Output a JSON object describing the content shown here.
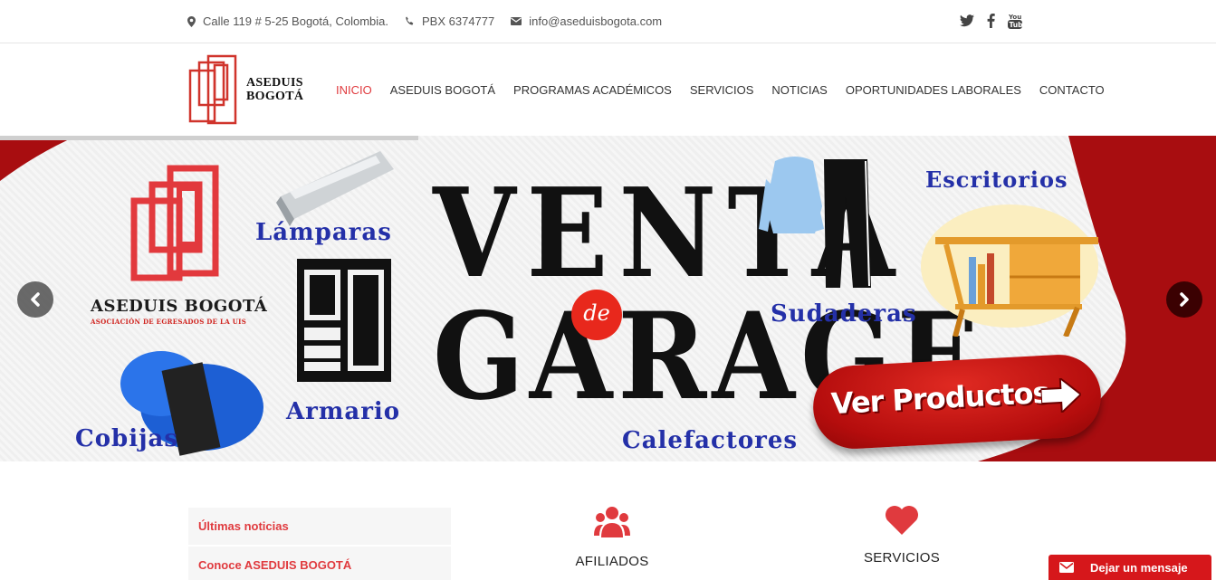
{
  "topbar": {
    "address": "Calle 119 # 5-25 Bogotá, Colombia.",
    "phone": "PBX 6374777",
    "email": "info@aseduisbogota.com"
  },
  "header": {
    "logo_line1": "ASEDUIS",
    "logo_line2": "BOGOTÁ",
    "nav": [
      "INICIO",
      "ASEDUIS BOGOTÁ",
      "PROGRAMAS ACADÉMICOS",
      "SERVICIOS",
      "NOTICIAS",
      "OPORTUNIDADES LABORALES",
      "CONTACTO"
    ],
    "active_nav": "INICIO"
  },
  "hero": {
    "logo_title": "ASEDUIS BOGOTÁ",
    "logo_subtitle": "ASOCIACIÓN DE EGRESADOS DE LA UIS",
    "headline_line1": "VENTA",
    "headline_connector": "de",
    "headline_line2": "GARAGE",
    "items": {
      "lamparas": "Lámparas",
      "armario": "Armario",
      "cobijas": "Cobijas",
      "sudaderas": "Sudaderas",
      "escritorios": "Escritorios",
      "calefactores": "Calefactores"
    },
    "cta": "Ver Productos"
  },
  "sidebar": {
    "items": [
      "Últimas noticias",
      "Conoce ASEDUIS BOGOTÁ"
    ]
  },
  "features": [
    {
      "title": "AFILIADOS",
      "icon": "users-icon"
    },
    {
      "title": "SERVICIOS",
      "icon": "heart-icon"
    }
  ],
  "chat": {
    "label": "Dejar un mensaje"
  },
  "colors": {
    "accent": "#e03a3e",
    "hero_red": "#b50d0d",
    "hero_blue": "#2430a8"
  }
}
